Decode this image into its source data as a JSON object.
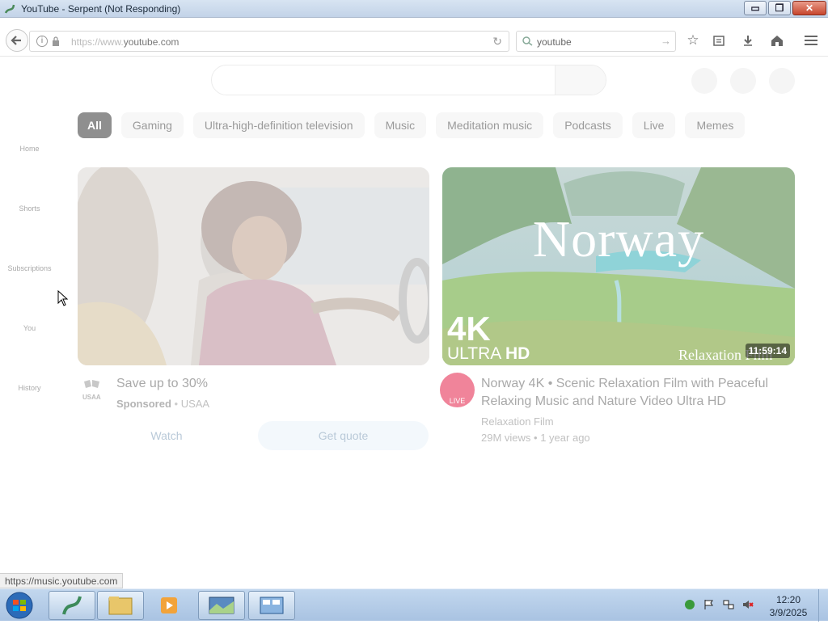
{
  "window": {
    "title": "YouTube - Serpent (Not Responding)",
    "controls": {
      "minimize": "▭",
      "restore": "❐",
      "close": "✕"
    }
  },
  "toolbar": {
    "url_dim": "https://www.",
    "url_main": "youtube.com",
    "search_value": "youtube",
    "icons": [
      "back-arrow-icon",
      "info-icon",
      "lock-icon",
      "reload-icon",
      "search-engine-icon",
      "go-arrow-icon",
      "bookmark-star-icon",
      "reading-list-icon",
      "download-icon",
      "home-icon",
      "menu-icon"
    ]
  },
  "chips": [
    "All",
    "Gaming",
    "Ultra-high-definition television",
    "Music",
    "Meditation music",
    "Podcasts",
    "Live",
    "Memes"
  ],
  "sidebar": [
    "Home",
    "Shorts",
    "Subscriptions",
    "You",
    "History"
  ],
  "ad": {
    "title": "Save up to 30%",
    "sponsored": "Sponsored",
    "advertiser": "USAA",
    "logo_text": "USAA",
    "watch": "Watch",
    "quote": "Get quote"
  },
  "video": {
    "thumb_title": "Norway",
    "badge_4k": "4K",
    "badge_ultra": "ULTRA",
    "badge_hd": "HD",
    "thumb_brand": "Relaxation Film",
    "duration": "11:59:14",
    "title_line1": "Norway 4K • Scenic Relaxation Film with Peaceful",
    "title_line2": "Relaxing Music and Nature Video Ultra HD",
    "channel": "Relaxation Film",
    "live_label": "LIVE",
    "views": "29M views",
    "age": "1 year ago"
  },
  "status_url": "https://music.youtube.com",
  "taskbar": {
    "time": "12:20",
    "date": "3/9/2025"
  },
  "colors": {
    "accent_live": "#f0849a",
    "chip_active": "#8f8f8f"
  }
}
